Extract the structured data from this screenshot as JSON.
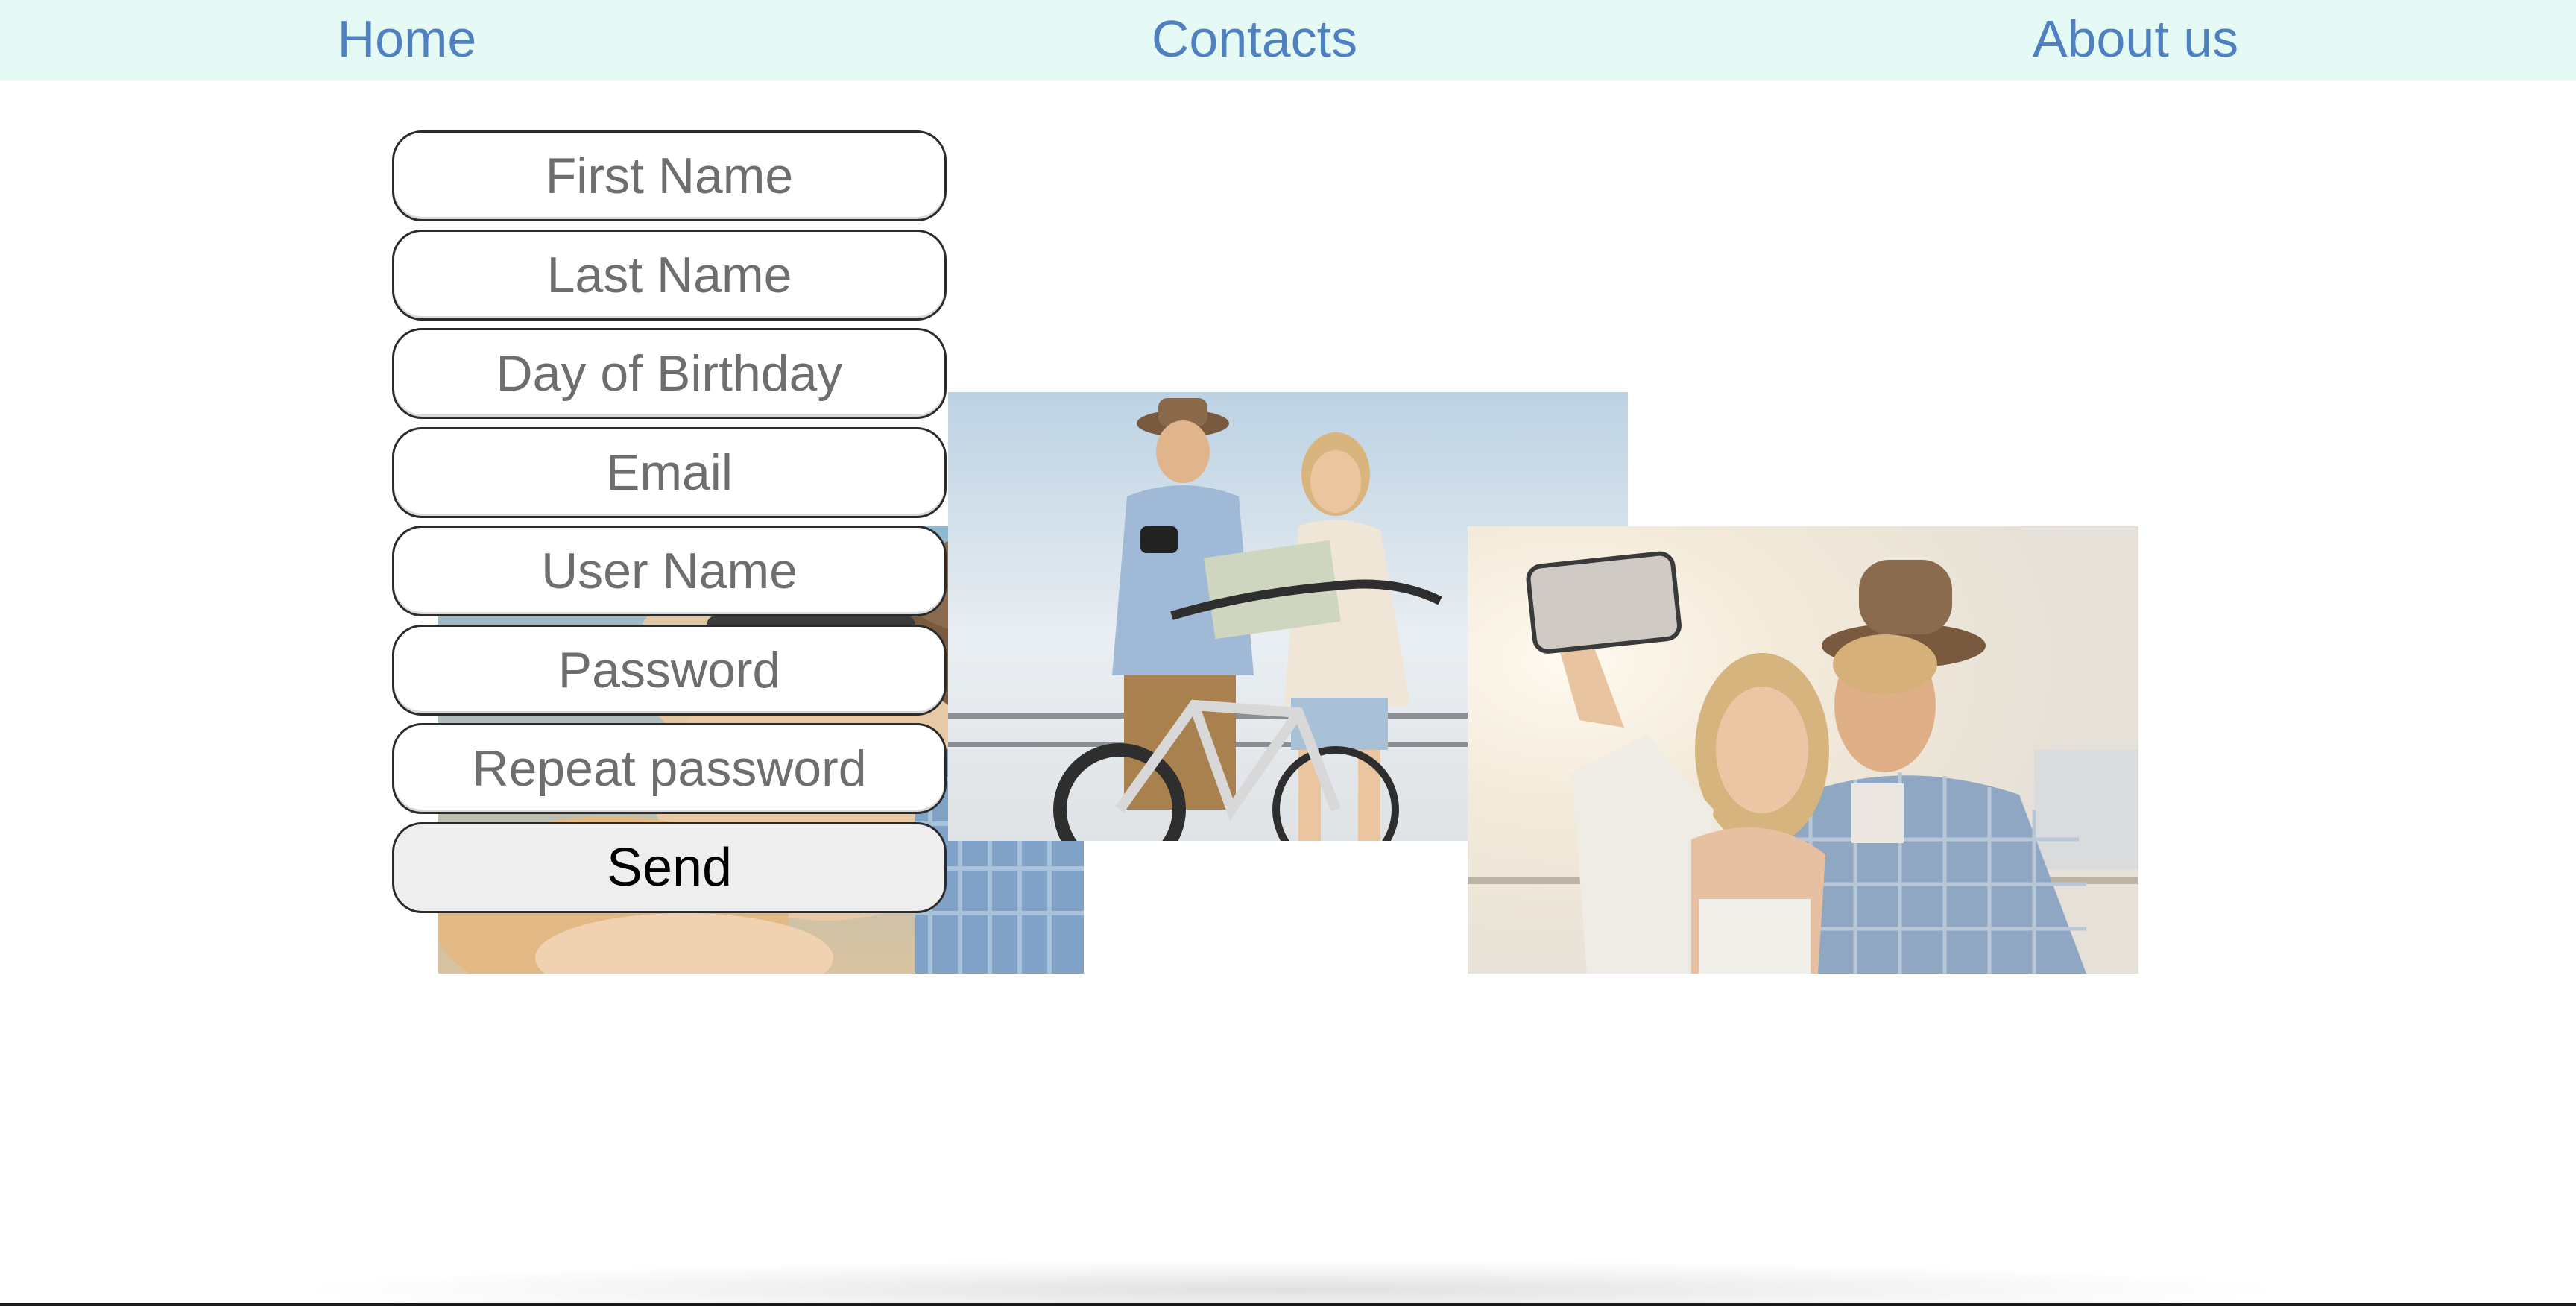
{
  "nav": {
    "home": "Home",
    "contacts": "Contacts",
    "about": "About us",
    "background": "#e6faf5",
    "link_color": "#4f80c0"
  },
  "form": {
    "first_name_placeholder": "First Name",
    "last_name_placeholder": "Last Name",
    "birthday_placeholder": "Day of Birthday",
    "email_placeholder": "Email",
    "username_placeholder": "User Name",
    "password_placeholder": "Password",
    "repeat_password_placeholder": "Repeat password",
    "send_label": "Send"
  },
  "photos": [
    {
      "subject": "couple-closeup-selfie"
    },
    {
      "subject": "couple-with-bicycle-and-map"
    },
    {
      "subject": "couple-taking-selfie-with-phone"
    }
  ]
}
